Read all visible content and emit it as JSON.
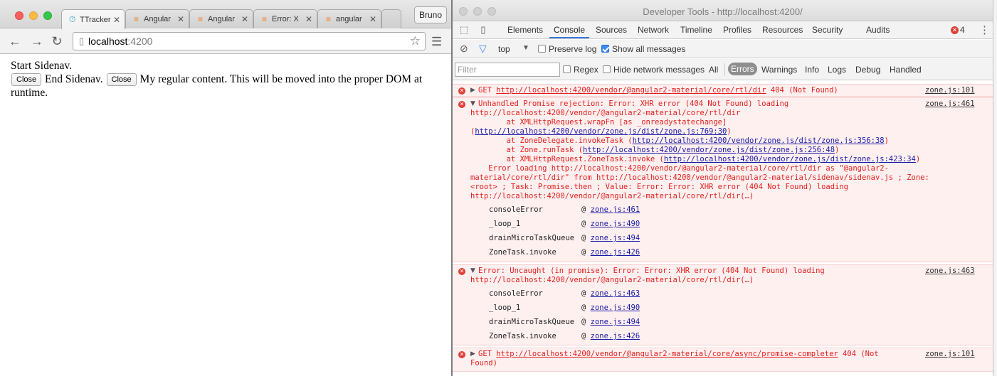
{
  "browser": {
    "tabs": [
      {
        "label": "TTracker",
        "icon": "timer-icon",
        "active": true
      },
      {
        "label": "Angular",
        "icon": "stackoverflow-icon"
      },
      {
        "label": "Angular",
        "icon": "stackoverflow-icon"
      },
      {
        "label": "Error: X",
        "icon": "stackoverflow-icon"
      },
      {
        "label": "angular",
        "icon": "stackoverflow-icon"
      }
    ],
    "profile": "Bruno",
    "url_host": "localhost",
    "url_port": ":4200",
    "page": {
      "start_text": "Start Sidenav.",
      "close1": "Close",
      "end_text": "End Sidenav.",
      "close2": "Close",
      "content": "My regular content. This will be moved into the proper DOM at runtime."
    }
  },
  "devtools": {
    "title": "Developer Tools - http://localhost:4200/",
    "tabs": [
      "Elements",
      "Console",
      "Sources",
      "Network",
      "Timeline",
      "Profiles",
      "Resources",
      "Security",
      "Audits"
    ],
    "active_tab": "Console",
    "error_count": "4",
    "context": "top",
    "preserve_log": "Preserve log",
    "show_all": "Show all messages",
    "filter_placeholder": "Filter",
    "regex": "Regex",
    "hide_network": "Hide network messages",
    "levels": [
      "All",
      "Errors",
      "Warnings",
      "Info",
      "Logs",
      "Debug",
      "Handled"
    ],
    "selected_level": "Errors",
    "messages": {
      "m1": {
        "get": "GET ",
        "url": "http://localhost:4200/vendor/@angular2-material/core/rtl/dir",
        "status": " 404 (Not Found)",
        "src": "zone.js:101"
      },
      "m2": {
        "line1": "Unhandled Promise rejection: Error: XHR error (404 Not Found) loading",
        "line2": "http://localhost:4200/vendor/@angular2-material/core/rtl/dir",
        "l3": "        at XMLHttpRequest.wrapFn [as _onreadystatechange]",
        "l4a": "(",
        "l4link": "http://localhost:4200/vendor/zone.js/dist/zone.js:769:30",
        "l4b": ")",
        "l5a": "        at ZoneDelegate.invokeTask (",
        "l5link": "http://localhost:4200/vendor/zone.js/dist/zone.js:356:38",
        "l5b": ")",
        "l6a": "        at Zone.runTask (",
        "l6link": "http://localhost:4200/vendor/zone.js/dist/zone.js:256:48",
        "l6b": ")",
        "l7a": "        at XMLHttpRequest.ZoneTask.invoke (",
        "l7link": "http://localhost:4200/vendor/zone.js/dist/zone.js:423:34",
        "l7b": ")",
        "l8": "    Error loading http://localhost:4200/vendor/@angular2-material/core/rtl/dir as \"@angular2-",
        "l9": "material/core/rtl/dir\" from http://localhost:4200/vendor/@angular2-material/sidenav/sidenav.js ; Zone:",
        "l10": "<root> ; Task: Promise.then ; Value: Error: Error: XHR error (404 Not Found) loading",
        "l11": "http://localhost:4200/vendor/@angular2-material/core/rtl/dir(…)",
        "src": "zone.js:461",
        "stack": [
          {
            "fn": "consoleError",
            "loc": "zone.js:461"
          },
          {
            "fn": "_loop_1",
            "loc": "zone.js:490"
          },
          {
            "fn": "drainMicroTaskQueue",
            "loc": "zone.js:494"
          },
          {
            "fn": "ZoneTask.invoke",
            "loc": "zone.js:426"
          }
        ]
      },
      "m3": {
        "line1": "Error: Uncaught (in promise): Error: Error: XHR error (404 Not Found) loading",
        "line2": "http://localhost:4200/vendor/@angular2-material/core/rtl/dir(…)",
        "src": "zone.js:463",
        "stack": [
          {
            "fn": "consoleError",
            "loc": "zone.js:463"
          },
          {
            "fn": "_loop_1",
            "loc": "zone.js:490"
          },
          {
            "fn": "drainMicroTaskQueue",
            "loc": "zone.js:494"
          },
          {
            "fn": "ZoneTask.invoke",
            "loc": "zone.js:426"
          }
        ]
      },
      "m4": {
        "get": "GET ",
        "url": "http://localhost:4200/vendor/@angular2-material/core/async/promise-completer",
        "status": " 404 (Not",
        "line2": "Found)",
        "src": "zone.js:101"
      }
    }
  }
}
